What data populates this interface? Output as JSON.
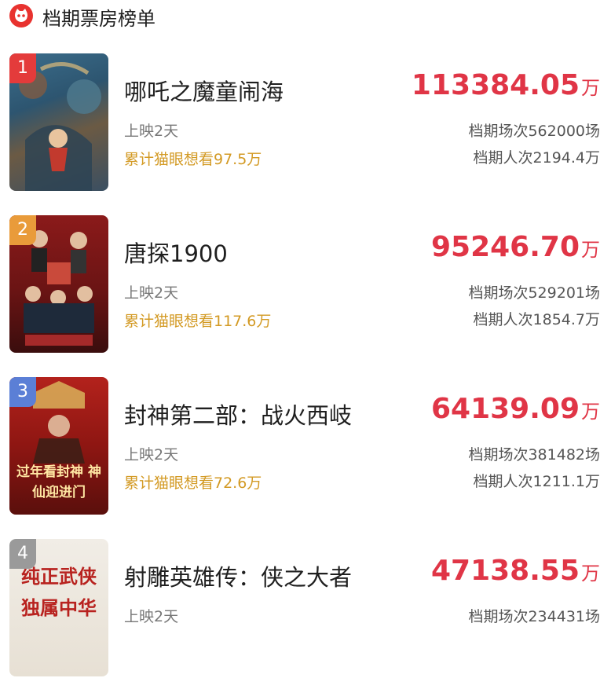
{
  "header": {
    "title": "档期票房榜单",
    "logo_icon": "cat-eye-logo-icon"
  },
  "colors": {
    "accent": "#e03546",
    "want": "#d39a24",
    "rank1": "#e43b3b",
    "rank2": "#e99b3a",
    "rank3": "#5b7fd6",
    "rank4": "#9a9a9a"
  },
  "movies": [
    {
      "rank": "1",
      "title": "哪吒之魔童闹海",
      "days": "上映2天",
      "want": "累计猫眼想看97.5万",
      "box_value": "113384.05",
      "box_unit": "万",
      "screenings": "档期场次562000场",
      "admissions": "档期人次2194.4万"
    },
    {
      "rank": "2",
      "title": "唐探1900",
      "days": "上映2天",
      "want": "累计猫眼想看117.6万",
      "box_value": "95246.70",
      "box_unit": "万",
      "screenings": "档期场次529201场",
      "admissions": "档期人次1854.7万"
    },
    {
      "rank": "3",
      "title": "封神第二部：战火西岐",
      "days": "上映2天",
      "want": "累计猫眼想看72.6万",
      "box_value": "64139.09",
      "box_unit": "万",
      "screenings": "档期场次381482场",
      "admissions": "档期人次1211.1万",
      "poster_text": "过年看封神 神仙迎进门"
    },
    {
      "rank": "4",
      "title": "射雕英雄传：侠之大者",
      "days": "上映2天",
      "box_value": "47138.55",
      "box_unit": "万",
      "screenings": "档期场次234431场",
      "poster_text": "纯正武侠 独属中华"
    }
  ]
}
